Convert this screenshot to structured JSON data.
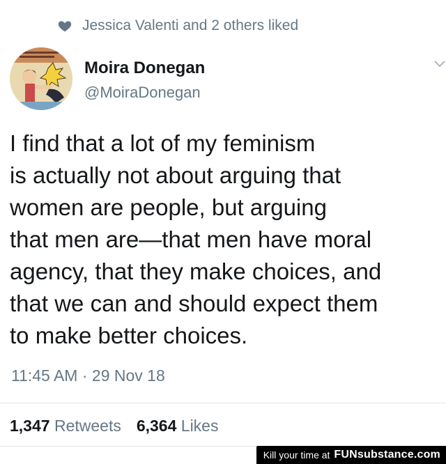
{
  "liked_by": {
    "icon": "heart-icon",
    "text": "Jessica Valenti and 2 others liked"
  },
  "author": {
    "name": "Moira Donegan",
    "handle": "@MoiraDonegan",
    "avatar": "vintage-comic-avatar"
  },
  "tweet": {
    "lines": [
      "I find that a lot of my feminism",
      "is actually not about arguing that",
      "women are people, but arguing",
      "that men are—that men have moral",
      "agency, that they make choices, and",
      "that we can and should expect them",
      "to make better choices."
    ],
    "timestamp": "11:45 AM · 29 Nov 18"
  },
  "stats": {
    "retweets_count": "1,347",
    "retweets_label": "Retweets",
    "likes_count": "6,364",
    "likes_label": "Likes"
  },
  "watermark": {
    "text": "Kill your time at",
    "logo": "FUNsubstance.com"
  },
  "colors": {
    "text": "#14171a",
    "secondary": "#657786",
    "divider": "#e1e8ed"
  }
}
